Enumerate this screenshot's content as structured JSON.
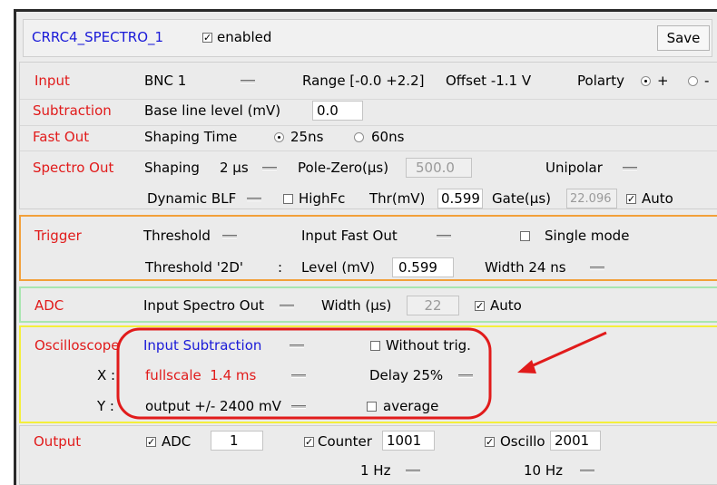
{
  "header": {
    "title": "CRRC4_SPECTRO_1",
    "enabled_label": "enabled",
    "enabled": true,
    "save_label": "Save"
  },
  "input": {
    "label": "Input",
    "source": "BNC 1",
    "range": "Range [-0.0 +2.2]",
    "offset": "Offset -1.1 V",
    "polarity_label": "Polarty",
    "pos_label": "+",
    "neg_label": "-",
    "polarity": "+"
  },
  "subtraction": {
    "label": "Subtraction",
    "baseline_label": "Base line level (mV)",
    "baseline_value": "0.0"
  },
  "fast_out": {
    "label": "Fast Out",
    "shaping_label": "Shaping Time",
    "opt1": "25ns",
    "opt2": "60ns",
    "selected": "25ns"
  },
  "spectro_out": {
    "label": "Spectro Out",
    "shaping_label": "Shaping",
    "shaping_value": "2 µs",
    "pole_zero_label": "Pole-Zero(µs)",
    "pole_zero_value": "500.0",
    "unipolar_label": "Unipolar",
    "dyn_blr_label": "Dynamic BLF",
    "highfc_label": "HighFc",
    "thr_label": "Thr(mV)",
    "thr_value": "0.599",
    "gate_label": "Gate(µs)",
    "gate_value": "22.096",
    "auto_label": "Auto"
  },
  "trigger": {
    "label": "Trigger",
    "threshold_label": "Threshold",
    "input_label": "Input Fast Out",
    "single_label": "Single mode",
    "threshold2d_label": "Threshold '2D'",
    "colon": ":",
    "level_label": "Level (mV)",
    "level_value": "0.599",
    "width_label": "Width 24 ns"
  },
  "adc": {
    "label": "ADC",
    "input_label": "Input Spectro Out",
    "width_label": "Width (µs)",
    "width_value": "22",
    "auto_label": "Auto"
  },
  "oscilloscope": {
    "label": "Oscilloscope",
    "input_label": "Input Subtraction",
    "without_trig_label": "Without trig.",
    "x_label": "X :",
    "fullscale_label": "fullscale  1.4 ms",
    "delay_label": "Delay 25%",
    "y_label": "Y :",
    "output_label": "output +/- 2400 mV",
    "average_label": "average"
  },
  "output": {
    "label": "Output",
    "adc_label": "ADC",
    "adc_value": "1",
    "counter_label": "Counter",
    "counter_value": "1001",
    "oscillo_label": "Oscillo",
    "oscillo_value": "2001",
    "rate1_label": "1 Hz",
    "rate2_label": "10 Hz"
  },
  "colors": {
    "accent_red": "#e11b1b",
    "accent_blue": "#1a1ad8",
    "trigger_border": "#f2a03a",
    "adc_border": "#a8e6b0",
    "osc_border": "#f4ef3c",
    "annotation_red": "#e11b1b"
  },
  "annotation": {
    "shape": "rounded-rectangle",
    "arrow": "pointing-left"
  }
}
